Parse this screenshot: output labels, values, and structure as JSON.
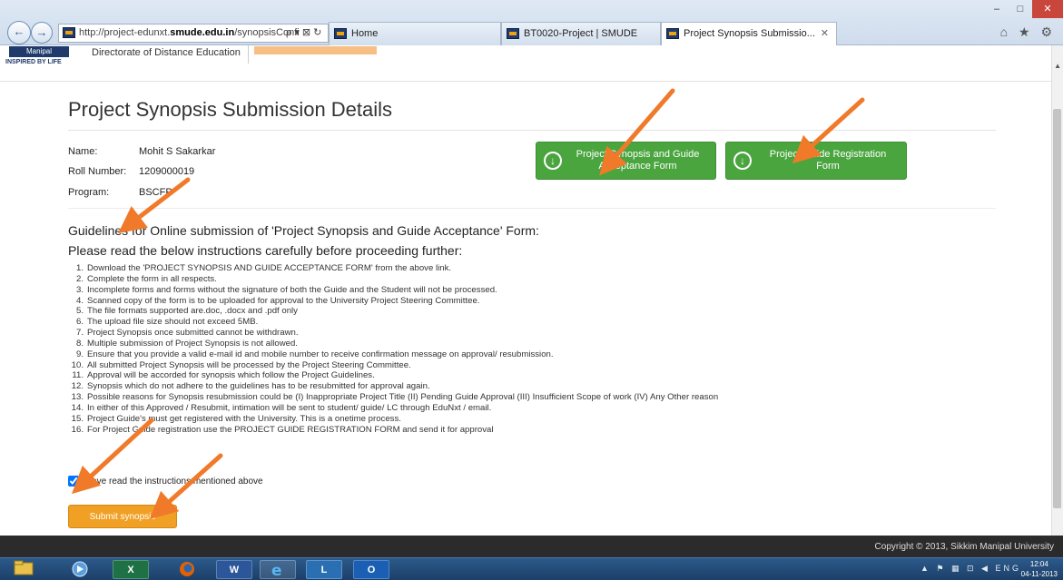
{
  "browser": {
    "window_controls": [
      "–",
      "□",
      "✕"
    ],
    "address": {
      "prefix": "http://project-edunxt.",
      "host": "smude.edu.in",
      "path": "/synopsisConfi",
      "icons": "ρ ▾ ⊠ ↻"
    },
    "tabs": [
      {
        "label": "Home",
        "active": false
      },
      {
        "label": "BT0020-Project | SMUDE",
        "active": false
      },
      {
        "label": "Project Synopsis Submissio...",
        "active": true,
        "close": "✕"
      }
    ],
    "right_icons": "⌂ ★ ⚙"
  },
  "site": {
    "logo_text": "Manipal",
    "logo_tagline": "INSPIRED BY LIFE",
    "directorate": "Directorate of Distance Education"
  },
  "page": {
    "title": "Project Synopsis Submission Details",
    "student": {
      "name_label": "Name:",
      "name_value": "Mohit S Sakarkar",
      "roll_label": "Roll Number:",
      "roll_value": "1209000019",
      "program_label": "Program:",
      "program_value": "BSCFP"
    },
    "downloads": [
      {
        "label": "Project Synopsis and Guide Acceptance Form"
      },
      {
        "label": "Project Guide Registration Form"
      }
    ],
    "guidelines_title": "Guidelines for Online submission of 'Project Synopsis and Guide Acceptance' Form:",
    "guidelines_sub": "Please read the below instructions carefully before proceeding further:",
    "instructions": [
      "Download the 'PROJECT SYNOPSIS AND GUIDE ACCEPTANCE FORM' from the above link.",
      "Complete the form in all respects.",
      "Incomplete forms and forms without the signature of both the Guide and the Student will not be processed.",
      "Scanned copy of the form is to be uploaded for approval to the University Project Steering Committee.",
      "The file formats supported are.doc, .docx and .pdf only",
      "The upload file size should not exceed 5MB.",
      "Project Synopsis once submitted cannot be withdrawn.",
      "Multiple submission of Project Synopsis is not allowed.",
      "Ensure that you provide a valid e-mail id and mobile number to receive confirmation message on approval/ resubmission.",
      "All submitted Project Synopsis will be processed by the Project Steering Committee.",
      "Approval will be accorded for synopsis which follow the Project Guidelines.",
      "Synopsis which do not adhere to the guidelines has to be resubmitted for approval again.",
      "Possible reasons for Synopsis resubmission could be (I) Inappropriate Project Title (II) Pending Guide Approval (III) Insufficient Scope of work (IV) Any Other reason",
      "In either of this Approved / Resubmit, intimation will be sent to student/ guide/ LC through EduNxt / email.",
      "Project Guide's must get registered with the University. This is a onetime process.",
      "For Project Guide registration use the PROJECT GUIDE REGISTRATION FORM and send it for approval"
    ],
    "checkbox_label": "I have read the instructions mentioned above",
    "checkbox_checked": true,
    "submit_label": "Submit synopsis"
  },
  "footer": {
    "copyright": "Copyright © 2013, Sikkim Manipal University"
  },
  "taskbar": {
    "apps": [
      "explorer-icon",
      "media-icon",
      "excel-icon",
      "firefox-icon",
      "word-icon",
      "ie-icon",
      "lync-icon",
      "outlook-icon"
    ],
    "excel_label": "X",
    "word_label": "W",
    "lync_label": "L",
    "outlook_label": "O",
    "tray": "▲ ⚑ ▦ ⊡ ◀",
    "lang": "ENG",
    "time": "12:04",
    "date": "04-11-2013"
  },
  "colors": {
    "green": "#4aa53f",
    "orange": "#f0a025",
    "arrow": "#f07a2a"
  }
}
